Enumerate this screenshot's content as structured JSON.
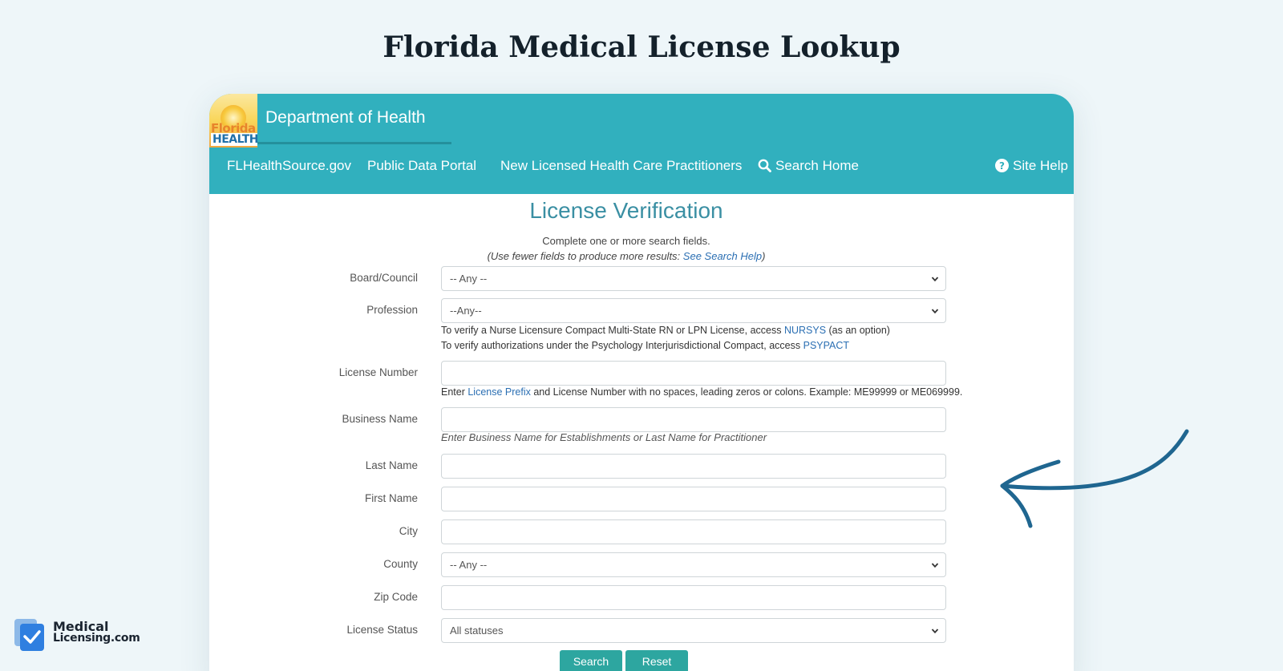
{
  "page": {
    "heading": "Florida Medical License Lookup"
  },
  "header": {
    "logo_line1": "Florida",
    "logo_line2": "HEALTH",
    "department": "Department of Health"
  },
  "nav": {
    "items": [
      {
        "label": "FLHealthSource.gov"
      },
      {
        "label": "Public Data Portal"
      },
      {
        "label": "New Licensed Health Care Practitioners"
      },
      {
        "label": "Search Home",
        "icon": "search-icon"
      },
      {
        "label": "Site Help",
        "icon": "help-icon"
      }
    ]
  },
  "form": {
    "title": "License Verification",
    "instruction1": "Complete one or more search fields.",
    "instruction2_prefix": "(Use fewer fields to produce more results: ",
    "instruction2_link": "See Search Help",
    "instruction2_suffix": ")",
    "board": {
      "label": "Board/Council",
      "value": "-- Any --"
    },
    "profession": {
      "label": "Profession",
      "value": "--Any--"
    },
    "nurse_note_prefix": "To verify a Nurse Licensure Compact Multi-State RN or LPN License, access ",
    "nurse_note_link": "NURSYS",
    "nurse_note_suffix": " (as an option)",
    "psych_note_prefix": "To verify authorizations under the Psychology Interjurisdictional Compact, access ",
    "psych_note_link": "PSYPACT",
    "license_number": {
      "label": "License Number",
      "value": ""
    },
    "license_note_prefix": "Enter ",
    "license_note_link": "License Prefix",
    "license_note_suffix": " and License Number with no spaces, leading zeros or colons. Example: ME99999 or ME069999.",
    "business_name": {
      "label": "Business Name",
      "value": ""
    },
    "business_hint": "Enter Business Name for Establishments or Last Name for Practitioner",
    "last_name": {
      "label": "Last Name",
      "value": ""
    },
    "first_name": {
      "label": "First Name",
      "value": ""
    },
    "city": {
      "label": "City",
      "value": ""
    },
    "county": {
      "label": "County",
      "value": "-- Any --"
    },
    "zip": {
      "label": "Zip Code",
      "value": ""
    },
    "status": {
      "label": "License Status",
      "value": "All statuses"
    },
    "search_button": "Search",
    "reset_button": "Reset"
  },
  "brand": {
    "line1": "Medical",
    "line2": "Licensing.com"
  },
  "colors": {
    "header": "#31b0be",
    "button": "#2da6a0",
    "arrow": "#1f6690",
    "title": "#3a8fa3",
    "link": "#2b6fb3"
  }
}
